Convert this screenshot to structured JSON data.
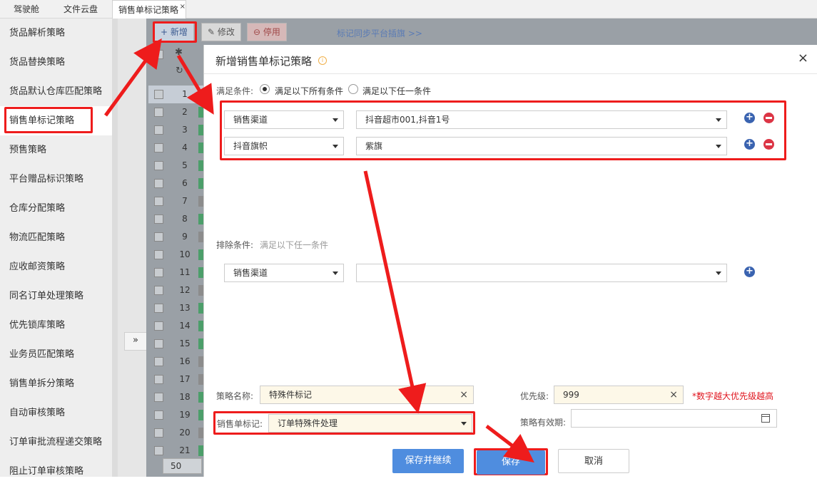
{
  "tabs": [
    "驾驶舱",
    "文件云盘",
    "销售单标记策略"
  ],
  "tab_close": "×",
  "sidebar": {
    "items": [
      "货品解析策略",
      "货品替换策略",
      "货品默认仓库匹配策略",
      "销售单标记策略",
      "预售策略",
      "平台赠品标识策略",
      "仓库分配策略",
      "物流匹配策略",
      "应收邮资策略",
      "同名订单处理策略",
      "优先锁库策略",
      "业务员匹配策略",
      "销售单拆分策略",
      "自动审核策略",
      "订单审批流程递交策略",
      "阻止订单审核策略"
    ],
    "active_index": 3
  },
  "collapse_label": "»",
  "toolbar": {
    "add_label": "+ 新增",
    "edit_label": "修改",
    "disable_label": "停用",
    "sync_link": "标记同步平台插旗 >>"
  },
  "grid": {
    "rows": [
      "1",
      "2",
      "3",
      "4",
      "5",
      "6",
      "7",
      "8",
      "9",
      "10",
      "11",
      "12",
      "13",
      "14",
      "15",
      "16",
      "17",
      "18",
      "19",
      "20",
      "21"
    ],
    "page_size": "50"
  },
  "modal": {
    "title": "新增销售单标记策略",
    "close": "×",
    "match_label": "满足条件:",
    "match_all": "满足以下所有条件",
    "match_any": "满足以下任一条件",
    "conditions": [
      {
        "field": "销售渠道",
        "value": "抖音超市001,抖音1号"
      },
      {
        "field": "抖音旗帜",
        "value": "紫旗"
      }
    ],
    "exclude_label": "排除条件:",
    "exclude_hint": "满足以下任一条件",
    "exclude": {
      "field": "销售渠道",
      "value": ""
    },
    "strategy_name_label": "策略名称:",
    "strategy_name": "特殊件标记",
    "priority_label": "优先级:",
    "priority": "999",
    "priority_hint": "*数字越大优先级越高",
    "mark_label": "销售单标记:",
    "mark_value": "订单特殊件处理",
    "validity_label": "策略有效期:",
    "validity_value": "",
    "save_continue": "保存并继续",
    "save": "保存",
    "cancel": "取消"
  }
}
